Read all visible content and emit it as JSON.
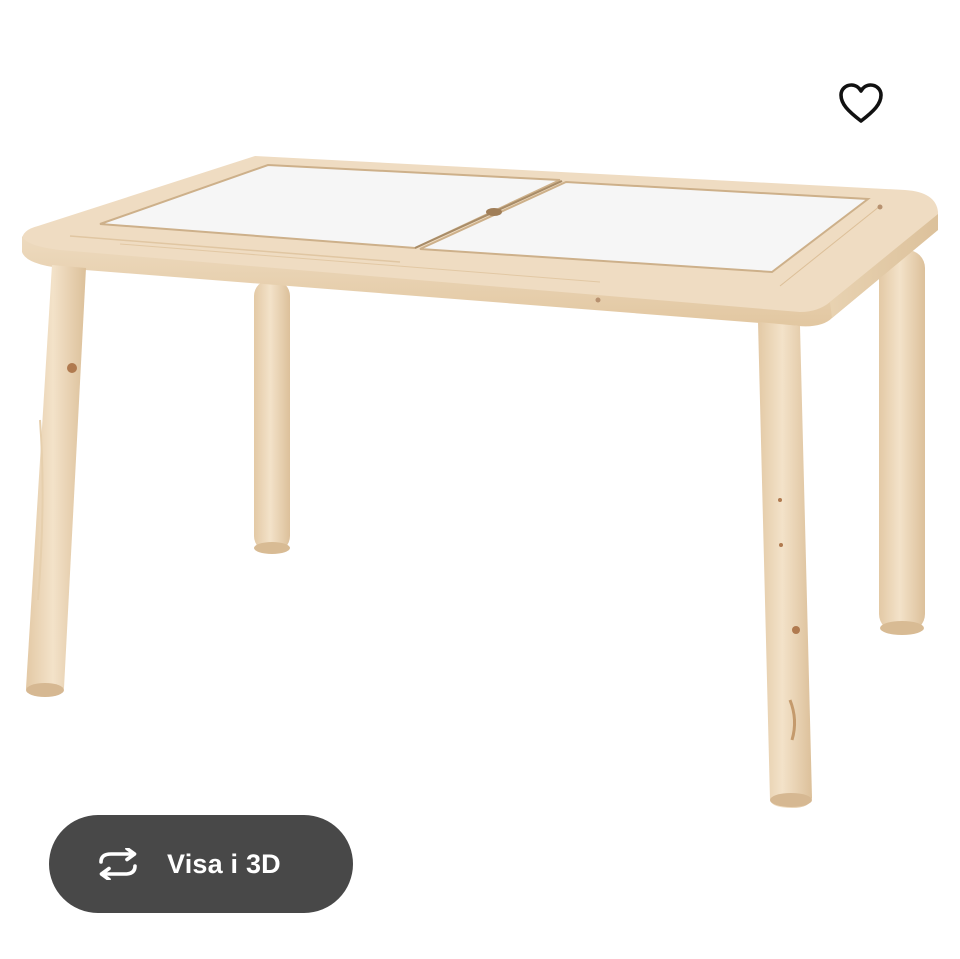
{
  "product": {
    "image_subject": "wooden-children-table",
    "colors": {
      "wood_light": "#efdcc2",
      "wood_mid": "#e6cfae",
      "wood_dark": "#d9bd97",
      "tabletop": "#f6f6f6",
      "seam": "#b89c7a"
    }
  },
  "favorite": {
    "icon": "heart-icon",
    "color": "#111111"
  },
  "view3d": {
    "label": "Visa i 3D",
    "icon": "rotate-3d-icon",
    "background": "#484848",
    "text_color": "#ffffff"
  }
}
